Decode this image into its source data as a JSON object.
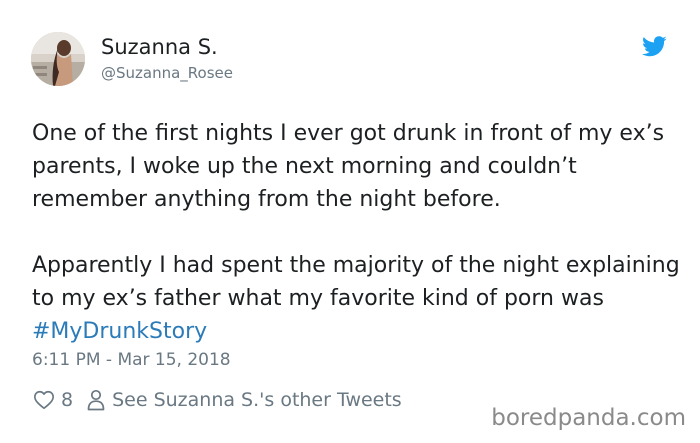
{
  "tweet": {
    "author_name": "Suzanna S.",
    "author_handle": "@Suzanna_Rosee",
    "paragraph1": "One of the first nights I ever got drunk in front of my ex’s parents, I woke up the next morning and couldn’t remember anything from the night before.",
    "paragraph2_text": "Apparently I had spent the majority of the night explaining to my ex’s father what my favorite kind of porn was ",
    "hashtag": "#MyDrunkStory",
    "timestamp": "6:11 PM - Mar 15, 2018",
    "like_count": "8",
    "other_tweets_link": "See Suzanna S.'s other Tweets"
  },
  "watermark": "boredpanda.com",
  "colors": {
    "text": "#1c2022",
    "secondary": "#697882",
    "link": "#2b7bb9",
    "twitter_blue": "#1da1f2"
  },
  "icons": {
    "brand": "twitter-bird-icon",
    "like": "heart-icon",
    "profile": "person-icon"
  }
}
